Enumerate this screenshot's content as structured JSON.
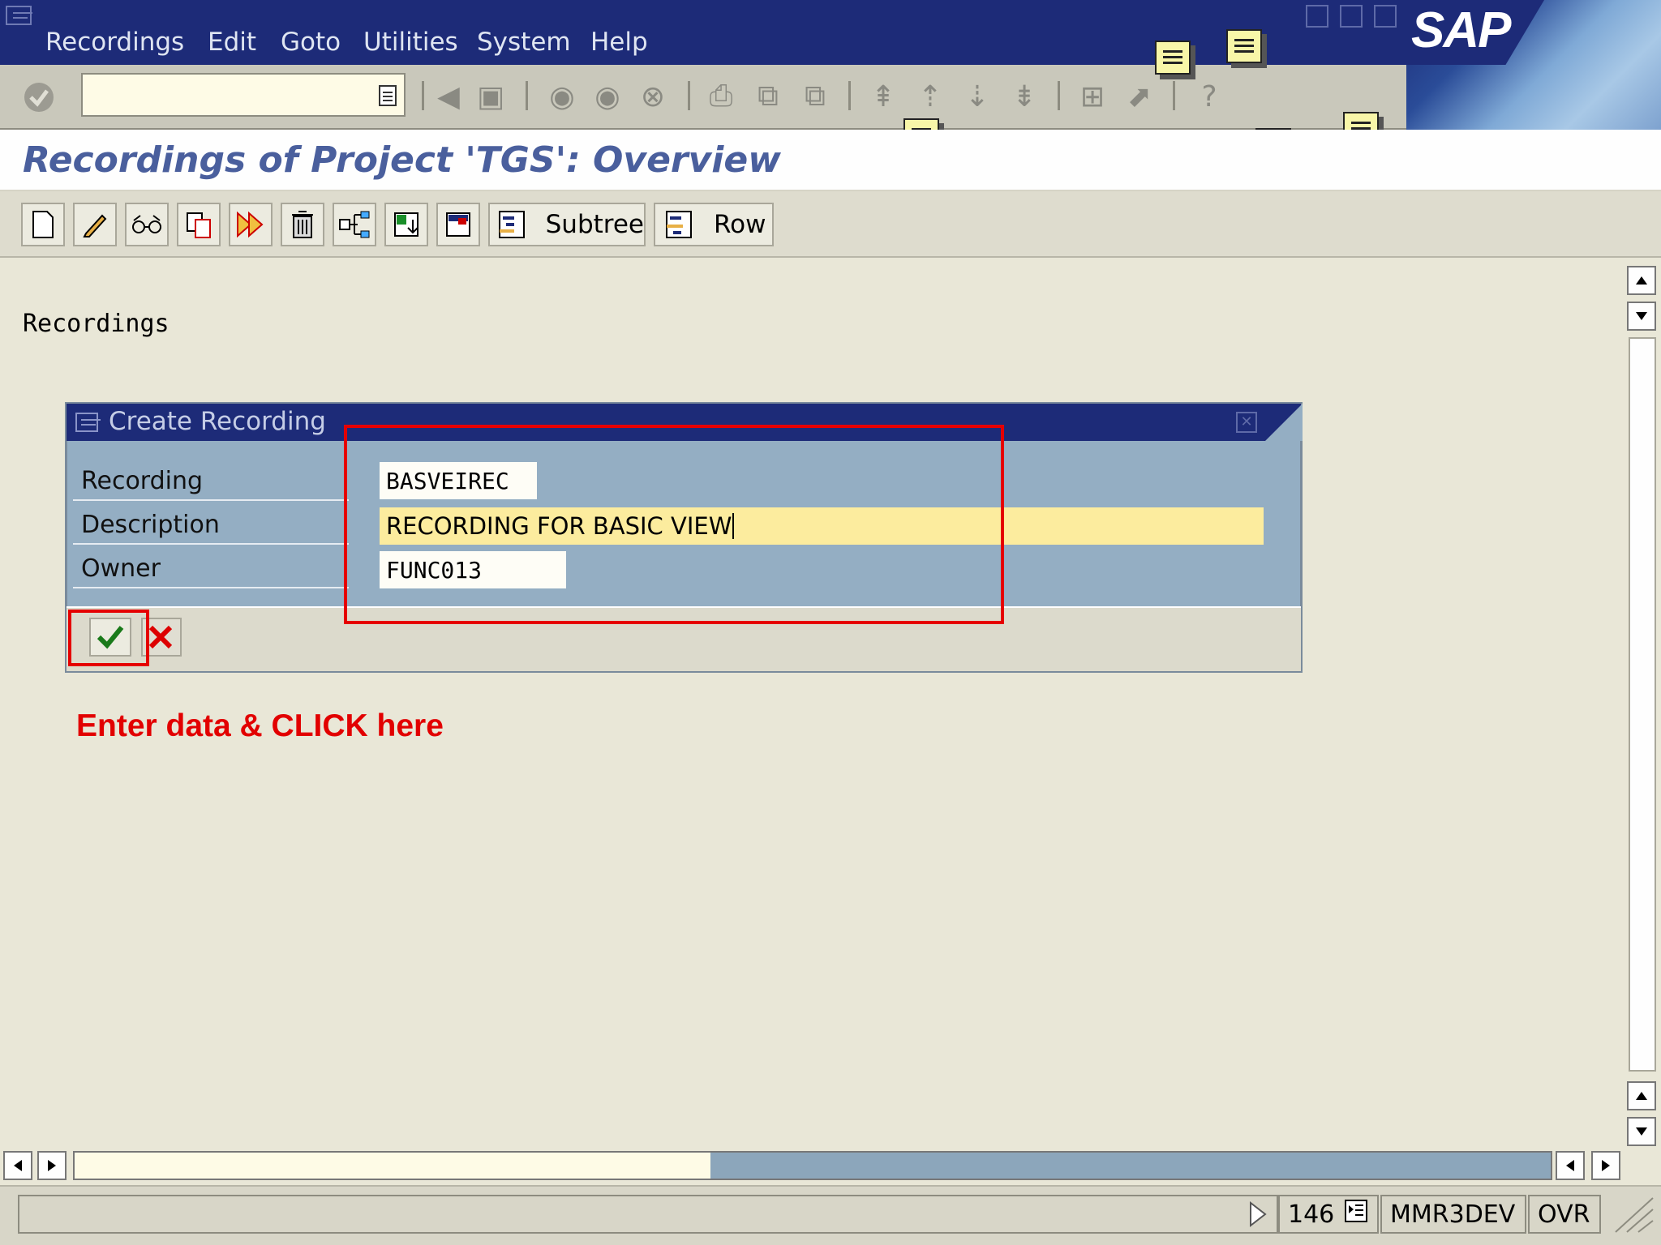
{
  "menu": {
    "items": [
      {
        "label": "Recordings"
      },
      {
        "label": "Edit"
      },
      {
        "label": "Goto"
      },
      {
        "label": "Utilities"
      },
      {
        "label": "System"
      },
      {
        "label": "Help"
      }
    ]
  },
  "logo": {
    "text": "SAP"
  },
  "screen": {
    "title": "Recordings of Project 'TGS': Overview"
  },
  "app_toolbar": {
    "subtree_label": "Subtree",
    "row_label": "Row"
  },
  "content": {
    "section_label": "Recordings"
  },
  "dialog": {
    "title": "Create Recording",
    "fields": {
      "recording": {
        "label": "Recording",
        "value": "BASVEIREC"
      },
      "description": {
        "label": "Description",
        "value": "RECORDING FOR BASIC VIEW"
      },
      "owner": {
        "label": "Owner",
        "value": "FUNC013"
      }
    }
  },
  "annotation": {
    "text": "Enter data & CLICK here"
  },
  "status": {
    "session_number": "146",
    "server": "MMR3DEV",
    "mode": "OVR"
  },
  "colors": {
    "titlebar": "#1d2b78",
    "annotation_red": "#e20000",
    "dialog_body": "#94aec3",
    "description_highlight": "#fcec9e"
  }
}
